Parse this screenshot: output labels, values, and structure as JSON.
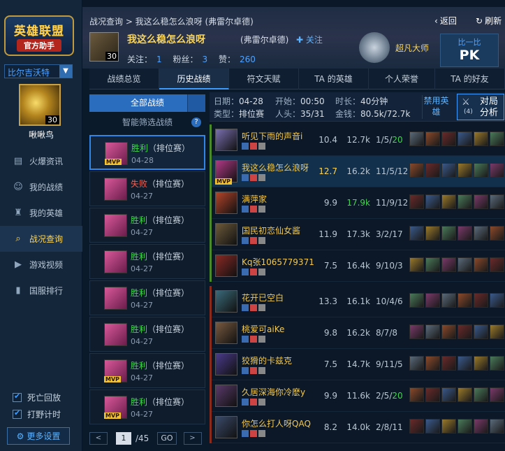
{
  "sidebar": {
    "logo_line1": "英雄联盟",
    "logo_line2": "官方助手",
    "server": "比尔吉沃特",
    "avatar_level": "30",
    "nickname": "啾啾鸟",
    "nav": [
      {
        "label": "火爆资讯",
        "icon": "document-icon"
      },
      {
        "label": "我的战绩",
        "icon": "person-icon"
      },
      {
        "label": "我的英雄",
        "icon": "helmet-icon"
      },
      {
        "label": "战况查询",
        "icon": "search-icon",
        "active": true
      },
      {
        "label": "游戏视频",
        "icon": "play-icon"
      },
      {
        "label": "国服排行",
        "icon": "bar-chart-icon"
      }
    ],
    "checks": [
      {
        "label": "死亡回放",
        "checked": true
      },
      {
        "label": "打野计时",
        "checked": true
      }
    ],
    "more_settings": "更多设置"
  },
  "header": {
    "breadcrumb": "战况查询 > 我这么稳怎么浪呀 (弗雷尔卓德)",
    "back": "返回",
    "refresh": "刷新",
    "player_level": "30",
    "player_name": "我这么稳怎么浪呀",
    "player_realm": "(弗雷尔卓德)",
    "follow": "关注",
    "follow_label": "关注：",
    "follow_count": "1",
    "fans_label": "粉丝：",
    "fans_count": "3",
    "likes_label": "赞：",
    "likes_count": "260",
    "rank": "超凡大师",
    "pk_line1": "比一比",
    "pk_line2": "PK"
  },
  "tabs": [
    "战绩总览",
    "历史战绩",
    "符文天赋",
    "TA 的英雄",
    "个人荣誉",
    "TA 的好友"
  ],
  "active_tab": 1,
  "match_list": {
    "filter_button": "全部战绩",
    "smart_filter": "智能筛选战绩",
    "help": "?",
    "items": [
      {
        "result": "胜利",
        "type": "（排位赛）",
        "date": "04-28",
        "mvp": true,
        "win": true,
        "selected": true
      },
      {
        "result": "失败",
        "type": "（排位赛）",
        "date": "04-27",
        "mvp": false,
        "win": false
      },
      {
        "result": "胜利",
        "type": "（排位赛）",
        "date": "04-27",
        "mvp": false,
        "win": true
      },
      {
        "result": "胜利",
        "type": "（排位赛）",
        "date": "04-27",
        "mvp": false,
        "win": true
      },
      {
        "result": "胜利",
        "type": "（排位赛）",
        "date": "04-27",
        "mvp": false,
        "win": true
      },
      {
        "result": "胜利",
        "type": "（排位赛）",
        "date": "04-27",
        "mvp": false,
        "win": true
      },
      {
        "result": "胜利",
        "type": "（排位赛）",
        "date": "04-27",
        "mvp": true,
        "win": true
      },
      {
        "result": "胜利",
        "type": "（排位赛）",
        "date": "04-27",
        "mvp": true,
        "win": true
      }
    ],
    "pager": {
      "prev": "<",
      "page": "1",
      "total": "/45",
      "go": "GO",
      "next": ">"
    }
  },
  "detail": {
    "date_label": "日期：",
    "date": "04-28",
    "start_label": "开始：",
    "start": "00:50",
    "duration_label": "时长：",
    "duration": "40分钟",
    "type_label": "类型：",
    "type": "排位赛",
    "kills_label": "人头：",
    "kills": "35/31",
    "gold_label": "金钱：",
    "gold": "80.5k/72.7k",
    "ban_button": "禁用英雄",
    "analysis_count": "(4)",
    "analysis_button": "对局分析",
    "players": [
      {
        "name": "听见下雨的声音i",
        "score": "10.4",
        "gold": "12.7k",
        "k": "1/5/",
        "k2": "20",
        "team": "blue",
        "color": "#7a6fb0"
      },
      {
        "name": "我这么稳怎么浪呀",
        "score": "12.7",
        "gold": "16.2k",
        "k": "11/5/12",
        "k2": "",
        "team": "blue",
        "mvp": true,
        "highlight": true,
        "color": "#b03a86"
      },
      {
        "name": "满萍家",
        "score": "9.9",
        "gold": "17.9k",
        "k": "11/9/12",
        "k2": "",
        "team": "blue",
        "color": "#b4452a",
        "gold_green": true
      },
      {
        "name": "国民初恋仙女酱",
        "score": "11.9",
        "gold": "17.3k",
        "k": "3/2/17",
        "k2": "",
        "team": "blue",
        "color": "#6d5a3a"
      },
      {
        "name": "Kq张1065779371",
        "score": "7.5",
        "gold": "16.4k",
        "k": "9/10/3",
        "k2": "",
        "team": "blue",
        "color": "#8a2a25"
      },
      {
        "name": "花开已空白",
        "score": "13.3",
        "gold": "16.1k",
        "k": "10/4/6",
        "k2": "",
        "team": "red",
        "color": "#3a6a7a"
      },
      {
        "name": "桃爱可aiKe",
        "score": "9.8",
        "gold": "16.2k",
        "k": "8/7/8",
        "k2": "",
        "team": "red",
        "color": "#7a5a40"
      },
      {
        "name": "狡猾的卡兹克",
        "score": "7.5",
        "gold": "14.7k",
        "k": "9/11/5",
        "k2": "",
        "team": "red",
        "color": "#4a3a8a"
      },
      {
        "name": "久居深海你冷麽y",
        "score": "9.9",
        "gold": "11.6k",
        "k": "2/5/",
        "k2": "20",
        "team": "red",
        "color": "#5a3a6a"
      },
      {
        "name": "你怎么打人呀QAQ",
        "score": "8.2",
        "gold": "14.0k",
        "k": "2/8/11",
        "k2": "",
        "team": "red",
        "color": "#3a4a6a"
      }
    ]
  },
  "colors": {
    "win": "#3fd84a",
    "loss": "#ff5a4a",
    "gold_text": "#fbd65a",
    "accent": "#3f9cff",
    "blue_team": "#4a8a2a",
    "red_team": "#8a2a1a"
  }
}
